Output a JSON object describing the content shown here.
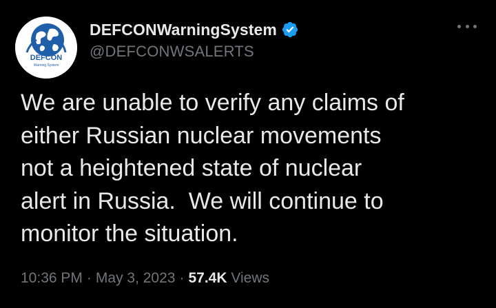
{
  "header": {
    "display_name": "DEFCONWarningSystem",
    "handle": "@DEFCONWSALERTS",
    "verified_icon": "verified-badge-icon",
    "more_icon": "more-options-icon"
  },
  "avatar": {
    "logo_text": "DEFCON",
    "logo_subtext": "Warning System"
  },
  "tweet": {
    "text": "We are unable to verify any claims of\neither Russian nuclear movements\nnot a heightened state of nuclear\nalert in Russia.  We will continue to\nmonitor the situation."
  },
  "meta": {
    "time": "10:36 PM",
    "separator": "·",
    "date": "May 3, 2023",
    "views_count": "57.4K",
    "views_label": "Views"
  },
  "colors": {
    "background": "#000000",
    "primary_text": "#e7e9ea",
    "secondary_text": "#71767b",
    "verified_blue": "#1d9bf0",
    "logo_blue": "#1f5faa"
  }
}
